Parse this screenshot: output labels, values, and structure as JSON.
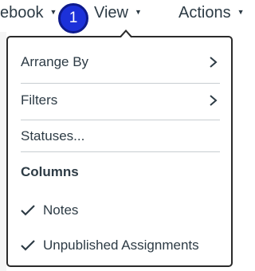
{
  "topbar": {
    "gradebook_label": "ebook",
    "view_label": "View",
    "actions_label": "Actions",
    "caret_glyph": "▼"
  },
  "badge": {
    "number": "1"
  },
  "menu": {
    "items": [
      {
        "label": "Arrange By",
        "has_submenu": true
      },
      {
        "label": "Filters",
        "has_submenu": true
      },
      {
        "label": "Statuses..."
      }
    ],
    "columns_heading": "Columns",
    "columns": [
      {
        "label": "Notes",
        "checked": true
      },
      {
        "label": "Unpublished Assignments",
        "checked": true
      }
    ]
  },
  "colors": {
    "badge": "#1c31d9",
    "text": "#2d3b45",
    "separator": "#c7cdd1"
  }
}
